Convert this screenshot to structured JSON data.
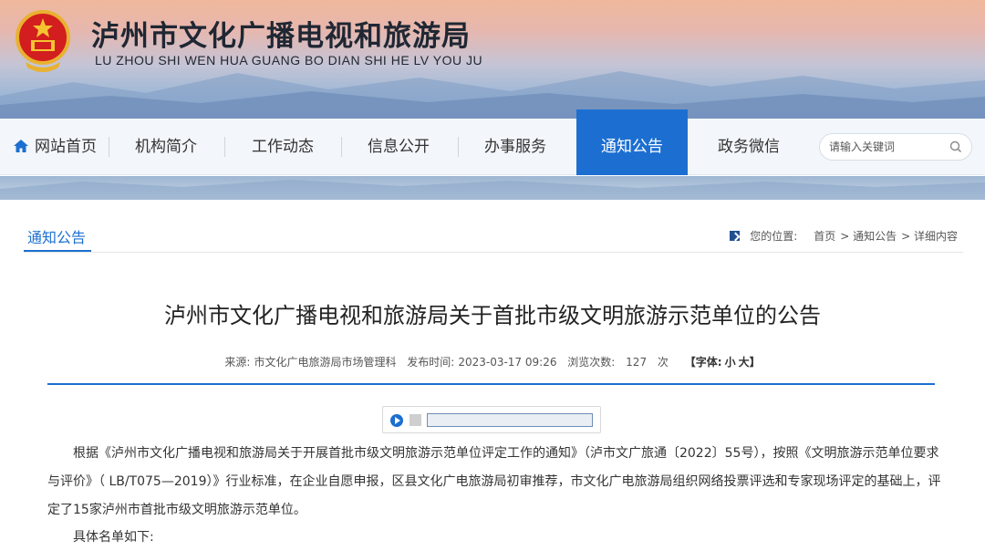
{
  "header": {
    "title": "泸州市文化广播电视和旅游局",
    "pinyin": "LU ZHOU SHI  WEN HUA GUANG BO DIAN SHI  HE  LV  YOU  JU"
  },
  "nav": {
    "items": [
      {
        "label": "网站首页",
        "icon": "home-icon"
      },
      {
        "label": "机构简介"
      },
      {
        "label": "工作动态"
      },
      {
        "label": "信息公开"
      },
      {
        "label": "办事服务"
      },
      {
        "label": "通知公告",
        "active": true
      },
      {
        "label": "政务微信"
      }
    ],
    "search_placeholder": "请输入关键词"
  },
  "section": {
    "title": "通知公告"
  },
  "breadcrumb": {
    "prefix": "您的位置:",
    "home": "首页",
    "level1": "> 通知公告",
    "level2": "> 详细内容"
  },
  "article": {
    "title": "泸州市文化广播电视和旅游局关于首批市级文明旅游示范单位的公告",
    "source_label": "来源:",
    "source": "市文化广电旅游局市场管理科",
    "date_label": "发布时间:",
    "date": "2023-03-17 09:26",
    "views_label": "浏览次数:",
    "views": "127",
    "views_unit": "次",
    "font_label": "【字体:",
    "font_small": "小",
    "font_large": "大】",
    "paragraph1": "根据《泸州市文化广播电视和旅游局关于开展首批市级文明旅游示范单位评定工作的通知》（泸市文广旅通〔2022〕55号），按照《文明旅游示范单位要求与评价》（ LB/T075—2019）》行业标准，在企业自愿申报，区县文化广电旅游局初审推荐，市文化广电旅游局组织网络投票评选和专家现场评定的基础上，评定了15家泸州市首批市级文明旅游示范单位。",
    "paragraph2": "具体名单如下:"
  },
  "colors": {
    "accent": "#1c6fd1",
    "title_text": "#1f2733"
  }
}
